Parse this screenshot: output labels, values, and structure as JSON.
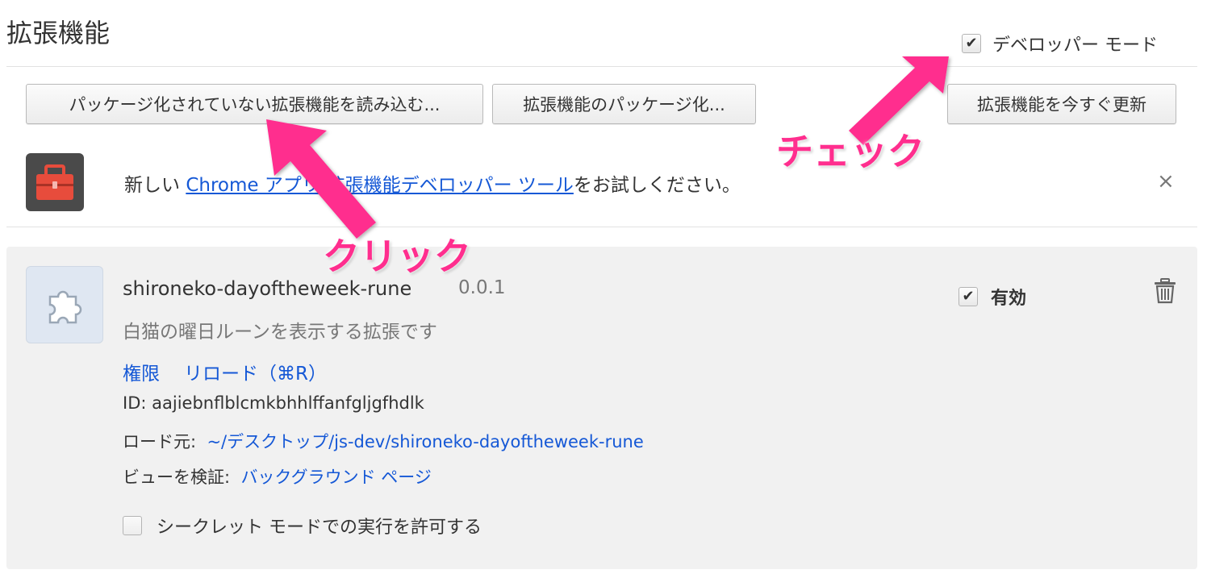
{
  "header": {
    "title": "拡張機能",
    "developer_mode_label": "デベロッパー モード",
    "developer_mode_checked": true
  },
  "toolbar": {
    "load_unpacked_label": "パッケージ化されていない拡張機能を読み込む...",
    "pack_label": "拡張機能のパッケージ化...",
    "update_label": "拡張機能を今すぐ更新"
  },
  "notice": {
    "prefix": "新しい ",
    "link_text": "Chrome アプリ/拡張機能デベロッパー ツール",
    "suffix": "をお試しください。",
    "close_label": "×",
    "icon": "toolbox-icon"
  },
  "extension": {
    "name": "shironeko-dayoftheweek-rune",
    "version": "0.0.1",
    "description": "白猫の曜日ルーンを表示する拡張です",
    "permissions_link": "権限",
    "reload_link": "リロード（⌘R）",
    "id_label": "ID: ",
    "id_value": "aajiebnflblcmkbhhlffanfgljgfhdlk",
    "load_from_label": "ロード元:",
    "load_from_path": "~/デスクトップ/js-dev/shironeko-dayoftheweek-rune",
    "inspect_label": "ビューを検証:",
    "inspect_link": "バックグラウンド ページ",
    "incognito_label": "シークレット モードでの実行を許可する",
    "incognito_checked": false,
    "enabled_label": "有効",
    "enabled_checked": true,
    "icon": "puzzle-piece-icon"
  },
  "annotations": {
    "check": "チェック",
    "click": "クリック",
    "color": "#ff2e8e"
  }
}
